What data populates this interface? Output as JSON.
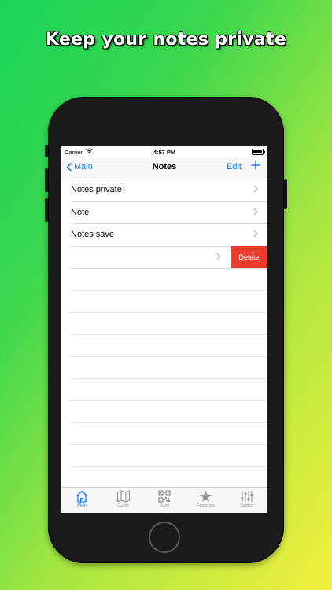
{
  "headline": "Keep your notes private",
  "status_bar": {
    "carrier": "Carrier",
    "time": "4:57 PM"
  },
  "nav": {
    "back_label": "Main",
    "title": "Notes",
    "edit_label": "Edit"
  },
  "notes": [
    {
      "label": "Notes private"
    },
    {
      "label": "Note"
    },
    {
      "label": "Notes save"
    },
    {
      "label": ""
    }
  ],
  "delete_label": "Delete",
  "tabs": [
    {
      "label": "Main",
      "icon": "home-icon",
      "active": true
    },
    {
      "label": "Guide",
      "icon": "map-icon",
      "active": false
    },
    {
      "label": "Scan",
      "icon": "qr-code-icon",
      "active": false
    },
    {
      "label": "Favorites",
      "icon": "star-icon",
      "active": false
    },
    {
      "label": "Setting",
      "icon": "sliders-icon",
      "active": false
    }
  ],
  "colors": {
    "accent": "#1f7cf5",
    "delete": "#ee3b30",
    "inactive": "#9a9a9a"
  }
}
